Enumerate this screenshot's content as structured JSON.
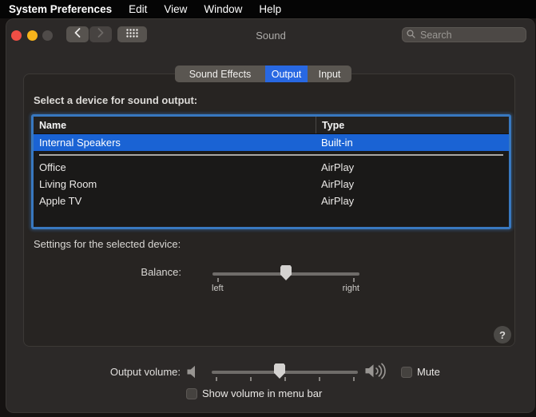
{
  "menu_bar": {
    "app_name": "System Preferences",
    "items": [
      {
        "label": "Edit"
      },
      {
        "label": "View"
      },
      {
        "label": "Window"
      },
      {
        "label": "Help"
      }
    ]
  },
  "window": {
    "title": "Sound",
    "search_placeholder": "Search"
  },
  "tabs": [
    {
      "label": "Sound Effects",
      "selected": false
    },
    {
      "label": "Output",
      "selected": true
    },
    {
      "label": "Input",
      "selected": false
    }
  ],
  "output_panel": {
    "select_device_label": "Select a device for sound output:",
    "table": {
      "columns": [
        {
          "label": "Name"
        },
        {
          "label": "Type"
        }
      ],
      "rows": [
        {
          "name": "Internal Speakers",
          "type": "Built-in",
          "selected": true
        },
        {
          "name": "Office",
          "type": "AirPlay",
          "selected": false
        },
        {
          "name": "Living Room",
          "type": "AirPlay",
          "selected": false
        },
        {
          "name": "Apple TV",
          "type": "AirPlay",
          "selected": false
        }
      ]
    },
    "settings_label": "Settings for the selected device:",
    "balance": {
      "label": "Balance:",
      "min_label": "left",
      "max_label": "right",
      "value_percent": 50
    },
    "help_button_label": "?"
  },
  "bottom_bar": {
    "output_volume_label": "Output volume:",
    "volume_percent": 46,
    "mute_label": "Mute",
    "mute_checked": false,
    "show_volume_label": "Show volume in menu bar",
    "show_volume_checked": false
  },
  "colors": {
    "accent_blue": "#2868e2",
    "selection_blue": "#1a63d4",
    "focus_ring_blue": "#3878c0",
    "traffic_red": "#f04e45",
    "traffic_yellow": "#f6b31b"
  }
}
